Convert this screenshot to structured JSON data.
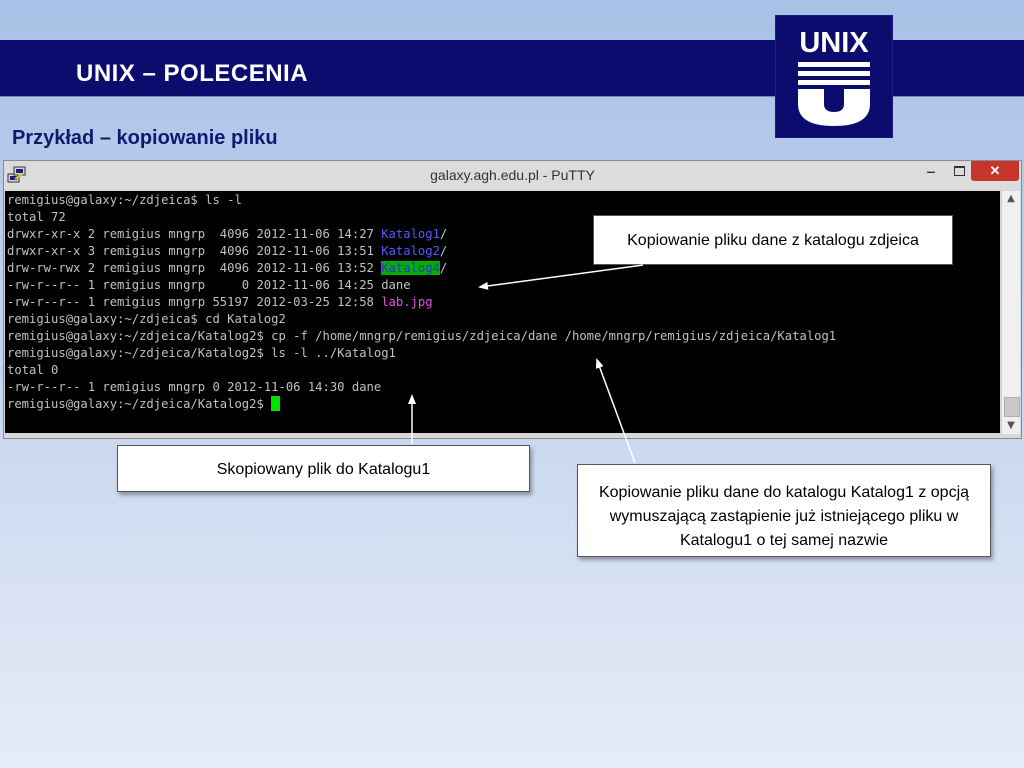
{
  "slide": {
    "title": "UNIX – POLECENIA",
    "subtitle": "Przykład – kopiowanie pliku",
    "logo_text": "UNIX"
  },
  "window": {
    "title": "galaxy.agh.edu.pl - PuTTY",
    "minimize_icon": "minimize-icon",
    "maximize_icon": "maximize-icon",
    "close_icon": "close-icon"
  },
  "terminal": {
    "l1": "remigius@galaxy:~/zdjeica$ ls -l",
    "l2": "total 72",
    "l3_pre": "drwxr-xr-x 2 remigius mngrp  4096 2012-11-06 14:27 ",
    "l3_dir": "Katalog1",
    "l4_pre": "drwxr-xr-x 3 remigius mngrp  4096 2012-11-06 13:51 ",
    "l4_dir": "Katalog2",
    "l5_pre": "drw-rw-rwx 2 remigius mngrp  4096 2012-11-06 13:52 ",
    "l5_dir": "Katalog4",
    "slash": "/",
    "l6": "-rw-r--r-- 1 remigius mngrp     0 2012-11-06 14:25 dane",
    "l7_pre": "-rw-r--r-- 1 remigius mngrp 55197 2012-03-25 12:58 ",
    "l7_file": "lab.jpg",
    "l8": "remigius@galaxy:~/zdjeica$ cd Katalog2",
    "l9": "remigius@galaxy:~/zdjeica/Katalog2$ cp -f /home/mngrp/remigius/zdjeica/dane /home/mngrp/remigius/zdjeica/Katalog1",
    "l10": "remigius@galaxy:~/zdjeica/Katalog2$ ls -l ../Katalog1",
    "l11": "total 0",
    "l12": "-rw-r--r-- 1 remigius mngrp 0 2012-11-06 14:30 dane",
    "l13": "remigius@galaxy:~/zdjeica/Katalog2$ "
  },
  "callouts": {
    "c1": "Kopiowanie pliku dane z katalogu zdjeica",
    "c2": "Skopiowany plik do Katalogu1",
    "c3": "Kopiowanie pliku dane do katalogu Katalog1 z opcją wymuszającą zastąpienie już istniejącego pliku w Katalogu1 o tej samej nazwie"
  },
  "colors": {
    "title_bar": "#0c0c6e",
    "terminal_bg": "#000000",
    "terminal_text": "#c0c0c0",
    "dir_blue": "#5858ff",
    "dir_highlight": "#00b000",
    "image_file": "#e050e0",
    "close_button": "#c7362c"
  }
}
